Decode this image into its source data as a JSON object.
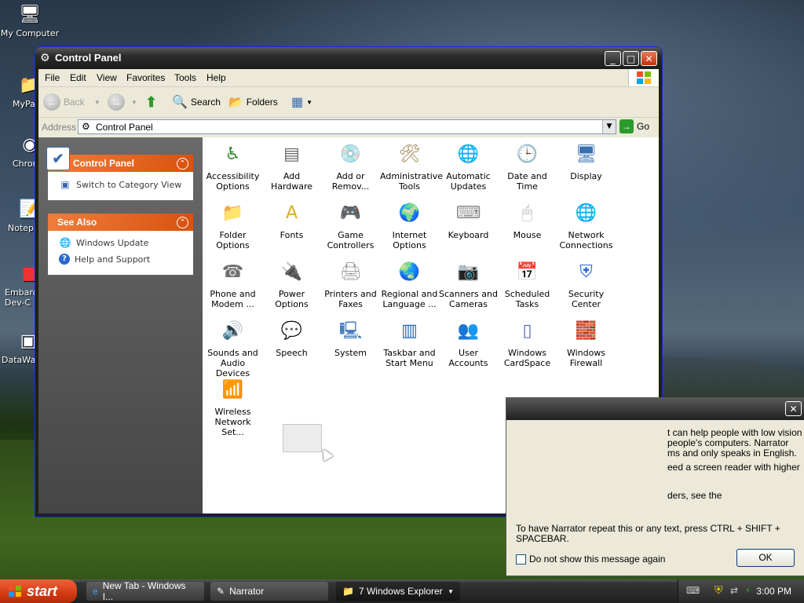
{
  "desktop": {
    "icons": [
      {
        "label": "My Computer",
        "icon": "computer-icon"
      },
      {
        "label": "MyPa",
        "icon": "folder-icon"
      },
      {
        "label": "Chrom",
        "icon": "chrome-icon"
      },
      {
        "label": "Notepa",
        "icon": "notepad-icon"
      },
      {
        "label": "Embarca Dev-C",
        "icon": "devcpp-icon"
      },
      {
        "label": "DataWa",
        "icon": "shortcut-icon"
      }
    ]
  },
  "window": {
    "title": "Control Panel",
    "menu": [
      "File",
      "Edit",
      "View",
      "Favorites",
      "Tools",
      "Help"
    ],
    "toolbar": {
      "back": "Back",
      "search": "Search",
      "folders": "Folders"
    },
    "address": {
      "label": "Address",
      "value": "Control Panel",
      "go": "Go"
    },
    "leftpane": {
      "panel1": {
        "title": "Control Panel",
        "links": [
          "Switch to Category View"
        ]
      },
      "panel2": {
        "title": "See Also",
        "links": [
          "Windows Update",
          "Help and Support"
        ]
      }
    },
    "items": [
      {
        "label": "Accessibility Options",
        "icon": "accessibility-icon",
        "color": "#2a8a2a"
      },
      {
        "label": "Add Hardware",
        "icon": "add-hardware-icon",
        "color": "#6a6a6a"
      },
      {
        "label": "Add or Remov...",
        "icon": "add-remove-programs-icon",
        "color": "#5a7fc0"
      },
      {
        "label": "Administrative Tools",
        "icon": "administrative-tools-icon",
        "color": "#a08050"
      },
      {
        "label": "Automatic Updates",
        "icon": "automatic-updates-icon",
        "color": "#2a7ad0"
      },
      {
        "label": "Date and Time",
        "icon": "date-time-icon",
        "color": "#8a8a8a"
      },
      {
        "label": "Display",
        "icon": "display-icon",
        "color": "#3a70b0"
      },
      {
        "label": "Folder Options",
        "icon": "folder-options-icon",
        "color": "#e0b830"
      },
      {
        "label": "Fonts",
        "icon": "fonts-icon",
        "color": "#d8b020"
      },
      {
        "label": "Game Controllers",
        "icon": "game-controllers-icon",
        "color": "#7a7aa0"
      },
      {
        "label": "Internet Options",
        "icon": "internet-options-icon",
        "color": "#3a8ad0"
      },
      {
        "label": "Keyboard",
        "icon": "keyboard-icon",
        "color": "#8a8a8a"
      },
      {
        "label": "Mouse",
        "icon": "mouse-icon",
        "color": "#b0b0b0"
      },
      {
        "label": "Network Connections",
        "icon": "network-connections-icon",
        "color": "#2a80c0"
      },
      {
        "label": "Phone and Modem ...",
        "icon": "phone-modem-icon",
        "color": "#707070"
      },
      {
        "label": "Power Options",
        "icon": "power-options-icon",
        "color": "#909090"
      },
      {
        "label": "Printers and Faxes",
        "icon": "printers-faxes-icon",
        "color": "#9a9a9a"
      },
      {
        "label": "Regional and Language ...",
        "icon": "regional-language-icon",
        "color": "#2a70c0"
      },
      {
        "label": "Scanners and Cameras",
        "icon": "scanners-cameras-icon",
        "color": "#808080"
      },
      {
        "label": "Scheduled Tasks",
        "icon": "scheduled-tasks-icon",
        "color": "#e0c040"
      },
      {
        "label": "Security Center",
        "icon": "security-center-icon",
        "color": "#2a6ad0"
      },
      {
        "label": "Sounds and Audio Devices",
        "icon": "sounds-audio-icon",
        "color": "#7a7a7a"
      },
      {
        "label": "Speech",
        "icon": "speech-icon",
        "color": "#e0a020"
      },
      {
        "label": "System",
        "icon": "system-icon",
        "color": "#4a80c0"
      },
      {
        "label": "Taskbar and Start Menu",
        "icon": "taskbar-start-menu-icon",
        "color": "#2a6ab0"
      },
      {
        "label": "User Accounts",
        "icon": "user-accounts-icon",
        "color": "#d07030"
      },
      {
        "label": "Windows CardSpace",
        "icon": "cardspace-icon",
        "color": "#5a6ab0"
      },
      {
        "label": "Windows Firewall",
        "icon": "firewall-icon",
        "color": "#c04020"
      },
      {
        "label": "Wireless Network Set...",
        "icon": "wireless-network-icon",
        "color": "#4a8a4a"
      }
    ]
  },
  "narrator": {
    "lines": [
      "t can help people with low vision",
      "people's computers. Narrator",
      "ms and only speaks in English.",
      "eed a screen reader with higher",
      "ders, see the",
      "To have Narrator repeat this or any text, press CTRL + SHIFT +",
      "SPACEBAR."
    ],
    "checkbox": "Do not show this message again",
    "ok": "OK"
  },
  "taskbar": {
    "start": "start",
    "items": [
      "New Tab - Windows I...",
      "Narrator",
      "7 Windows Explorer"
    ],
    "clock": "3:00 PM"
  }
}
